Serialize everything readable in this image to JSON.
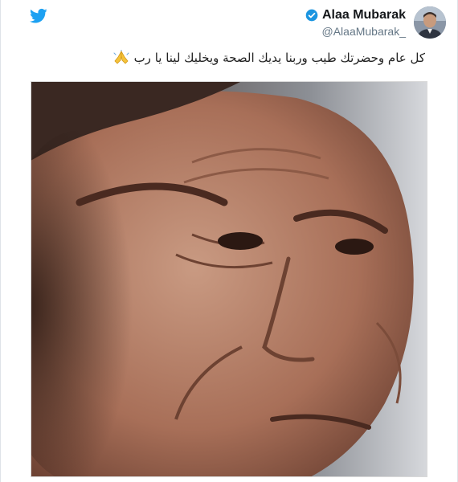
{
  "tweet": {
    "author": {
      "display_name": "Alaa Mubarak",
      "handle": "@AlaaMubarak_",
      "verified": true
    },
    "text": "كل عام وحضرتك طيب وربنا  يديك الصحة ويخليك لينا يا رب",
    "emoji": "folded-hands-emoji",
    "media": {
      "type": "photo",
      "description_icon": "portrait-photo"
    }
  },
  "icons": {
    "brand": "twitter-bird-icon",
    "verified": "verified-badge-icon"
  },
  "colors": {
    "twitter_blue": "#1da1f2",
    "verified_blue": "#1b95e0",
    "text": "#14171a",
    "handle": "#657786"
  }
}
